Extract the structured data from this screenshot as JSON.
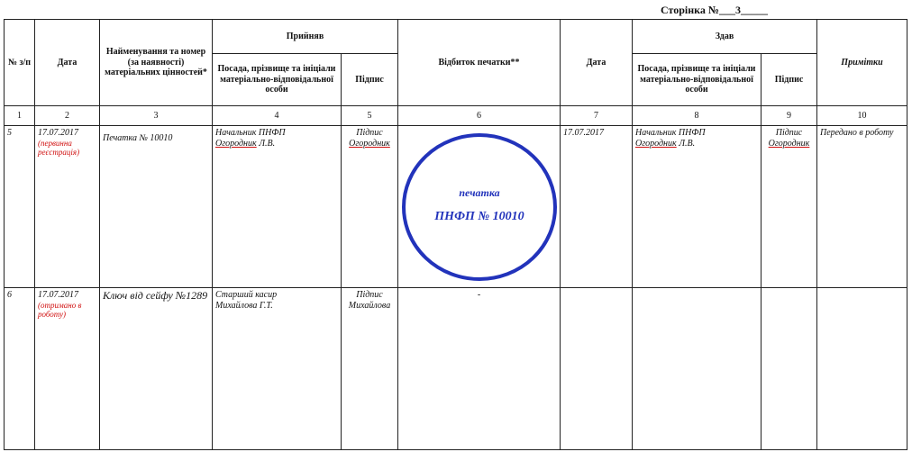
{
  "page_label": "Сторінка №___3_____",
  "header": {
    "col_no": "№ з/п",
    "col_date": "Дата",
    "col_name": "Найменування та номер (за наявності) матеріальних цінностей*",
    "group_received": "Прийняв",
    "col_position_received": "Посада, прізвище та ініціали матеріально-відповідальної особи",
    "col_signature_received": "Підпис",
    "col_stamp": "Відбиток печатки**",
    "col_date2": "Дата",
    "group_handed": "Здав",
    "col_position_handed": "Посада, прізвище та ініціали матеріально-відповідальної особи",
    "col_signature_handed": "Підпис",
    "col_notes": "Примітки"
  },
  "column_numbers": [
    "1",
    "2",
    "3",
    "4",
    "5",
    "6",
    "7",
    "8",
    "9",
    "10"
  ],
  "rows": [
    {
      "no": "5",
      "date": "17.07.2017",
      "date_note": "(первинна реєстрація)",
      "item": "Печатка № 10010",
      "received_position": "Начальник ПНФП",
      "received_name": "Огородник",
      "received_initials": " Л.В.",
      "received_signature_word": "Підпис",
      "received_signature_name": "Огородник",
      "stamp": {
        "line1": "печатка",
        "line2": "ПНФП № 10010",
        "color": "#2233bb"
      },
      "date2": "17.07.2017",
      "handed_position": "Начальник ПНФП",
      "handed_name": "Огородник",
      "handed_initials": " Л.В.",
      "handed_signature_word": "Підпис",
      "handed_signature_name": "Огородник",
      "notes": "Передано в роботу"
    },
    {
      "no": "6",
      "date": "17.07.2017",
      "date_note": "(отримано в роботу)",
      "item": "Ключ від сейфу №1289",
      "received_position": "Старший касир",
      "received_person": "Михайлова Г.Т.",
      "received_signature_word": "Підпис",
      "received_signature_name": "Михайлова",
      "stamp_text": "-",
      "date2": "",
      "handed_position": "",
      "handed_signature_word": "",
      "notes": ""
    }
  ]
}
